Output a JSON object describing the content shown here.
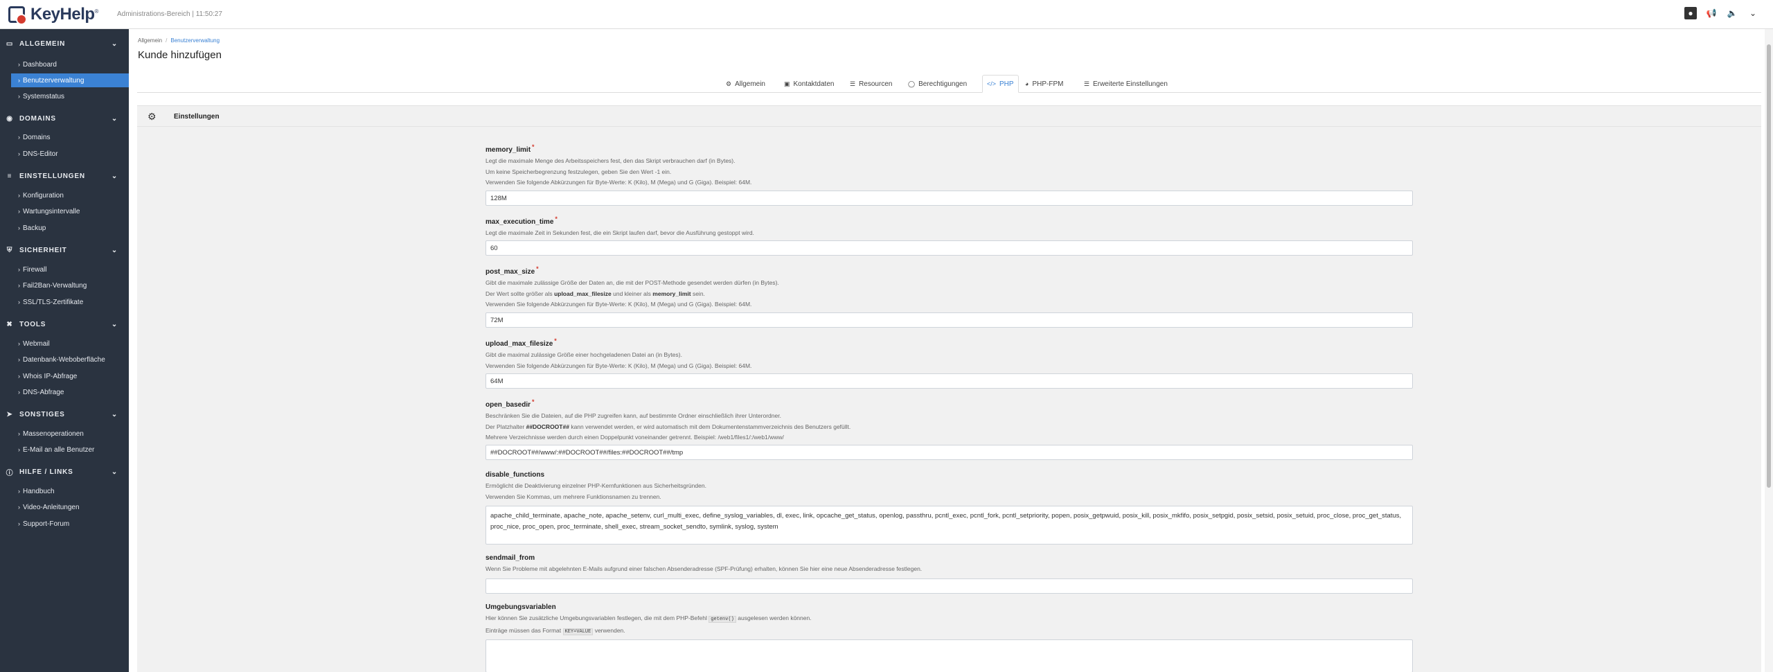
{
  "app": {
    "logo_text": "KeyHelp",
    "subtitle": "Administrations-Bereich | 11:50:27"
  },
  "topbar_icons": [
    "user-icon",
    "notifications-icon",
    "language-icon",
    "chevron-down-icon"
  ],
  "sidebar": {
    "allgemein": {
      "label": "ALLGEMEIN",
      "items": [
        "Dashboard",
        "Benutzerverwaltung",
        "Systemstatus"
      ]
    },
    "domains": {
      "label": "DOMAINS",
      "items": [
        "Domains",
        "DNS-Editor"
      ]
    },
    "einstellungen": {
      "label": "EINSTELLUNGEN",
      "items": [
        "Konfiguration",
        "Wartungsintervalle",
        "Backup"
      ]
    },
    "sicherheit": {
      "label": "SICHERHEIT",
      "items": [
        "Firewall",
        "Fail2Ban-Verwaltung",
        "SSL/TLS-Zertifikate"
      ]
    },
    "tools": {
      "label": "TOOLS",
      "items": [
        "Webmail",
        "Datenbank-Weboberfläche",
        "Whois IP-Abfrage",
        "DNS-Abfrage"
      ]
    },
    "sonstiges": {
      "label": "SONSTIGES",
      "items": [
        "Massenoperationen",
        "E-Mail an alle Benutzer"
      ]
    },
    "hilfe": {
      "label": "HILFE / LINKS",
      "items": [
        "Handbuch",
        "Video-Anleitungen",
        "Support-Forum"
      ]
    }
  },
  "breadcrumb": {
    "root": "Allgemein",
    "current": "Benutzerverwaltung"
  },
  "page_title": "Kunde hinzufügen",
  "tabs": [
    "Allgemein",
    "Kontaktdaten",
    "Resourcen",
    "Berechtigungen",
    "PHP",
    "PHP-FPM",
    "Erweiterte Einstellungen"
  ],
  "panel_title": "Einstellungen",
  "fields": {
    "memory_limit": {
      "label": "memory_limit",
      "desc1": "Legt die maximale Menge des Arbeitsspeichers fest, den das Skript verbrauchen darf (in Bytes).",
      "desc2": "Um keine Speicherbegrenzung festzulegen, geben Sie den Wert -1 ein.",
      "desc3": "Verwenden Sie folgende Abkürzungen für Byte-Werte: K (Kilo), M (Mega) und G (Giga). Beispiel: 64M.",
      "value": "128M"
    },
    "max_execution_time": {
      "label": "max_execution_time",
      "desc1": "Legt die maximale Zeit in Sekunden fest, die ein Skript laufen darf, bevor die Ausführung gestoppt wird.",
      "value": "60"
    },
    "post_max_size": {
      "label": "post_max_size",
      "desc1": "Gibt die maximale zulässige Größe der Daten an, die mit der POST-Methode gesendet werden dürfen (in Bytes).",
      "desc2a": "Der Wert sollte größer als",
      "desc2b": "upload_max_filesize",
      "desc2c": "und kleiner als",
      "desc2d": "memory_limit",
      "desc2e": "sein.",
      "desc3": "Verwenden Sie folgende Abkürzungen für Byte-Werte: K (Kilo), M (Mega) und G (Giga). Beispiel: 64M.",
      "value": "72M"
    },
    "upload_max_filesize": {
      "label": "upload_max_filesize",
      "desc1": "Gibt die maximal zulässige Größe einer hochgeladenen Datei an (in Bytes).",
      "desc2": "Verwenden Sie folgende Abkürzungen für Byte-Werte: K (Kilo), M (Mega) und G (Giga). Beispiel: 64M.",
      "value": "64M"
    },
    "open_basedir": {
      "label": "open_basedir",
      "desc1": "Beschränken Sie die Dateien, auf die PHP zugreifen kann, auf bestimmte Ordner einschließlich ihrer Unterordner.",
      "desc2a": "Der Platzhalter",
      "desc2b": "##DOCROOT##",
      "desc2c": "kann verwendet werden, er wird automatisch mit dem Dokumentenstammverzeichnis des Benutzers gefüllt.",
      "desc3": "Mehrere Verzeichnisse werden durch einen Doppelpunkt voneinander getrennt. Beispiel: /web1/files1/:/web1/www/",
      "value": "##DOCROOT##/www/:##DOCROOT##/files:##DOCROOT##/tmp"
    },
    "disable_functions": {
      "label": "disable_functions",
      "desc1": "Ermöglicht die Deaktivierung einzelner PHP-Kernfunktionen aus Sicherheitsgründen.",
      "desc2": "Verwenden Sie Kommas, um mehrere Funktionsnamen zu trennen.",
      "value": "apache_child_terminate, apache_note, apache_setenv, curl_multi_exec, define_syslog_variables, dl, exec, link, opcache_get_status, openlog, passthru, pcntl_exec, pcntl_fork, pcntl_setpriority, popen, posix_getpwuid, posix_kill, posix_mkfifo, posix_setpgid, posix_setsid, posix_setuid, proc_close, proc_get_status, proc_nice, proc_open, proc_terminate, shell_exec, stream_socket_sendto, symlink, syslog, system"
    },
    "sendmail_from": {
      "label": "sendmail_from",
      "desc1": "Wenn Sie Probleme mit abgelehnten E-Mails aufgrund einer falschen Absenderadresse (SPF-Prüfung) erhalten, können Sie hier eine neue Absenderadresse festlegen.",
      "value": ""
    },
    "umgebungsvariablen": {
      "label": "Umgebungsvariablen",
      "desc1a": "Hier können Sie zusätzliche Umgebungsvariablen festlegen, die mit dem PHP-Befehl",
      "desc1b": "getenv()",
      "desc1c": "ausgelesen werden können.",
      "desc2a": "Einträge müssen das Format",
      "desc2b": "KEY=VALUE",
      "desc2c": "verwenden.",
      "value": ""
    }
  }
}
